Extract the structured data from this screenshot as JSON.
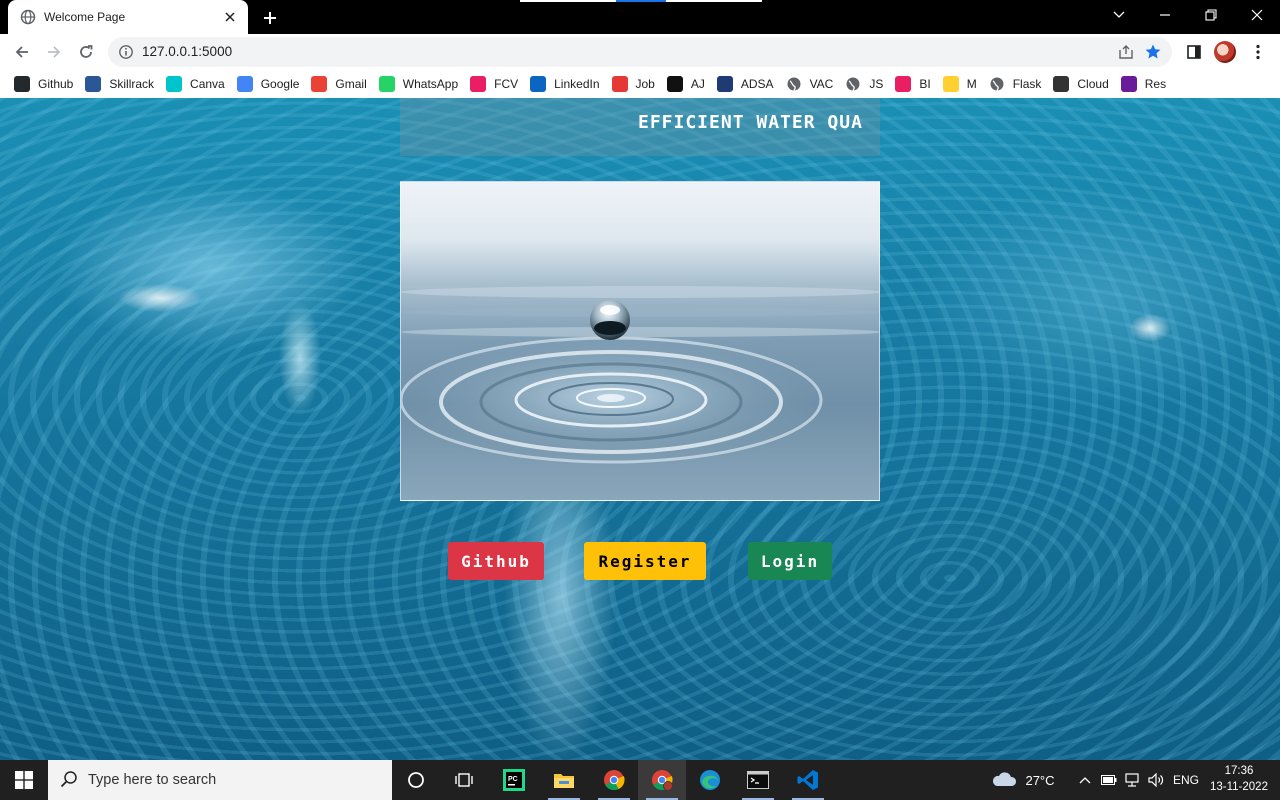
{
  "browser": {
    "tab_title": "Welcome Page",
    "url": "127.0.0.1:5000"
  },
  "bookmarks": [
    {
      "label": "Github",
      "icon": "github-icon",
      "color": "#24292e"
    },
    {
      "label": "Skillrack",
      "icon": "skillrack-icon",
      "color": "#2b5797"
    },
    {
      "label": "Canva",
      "icon": "canva-icon",
      "color": "#00c4cc"
    },
    {
      "label": "Google",
      "icon": "google-icon",
      "color": "#4285f4"
    },
    {
      "label": "Gmail",
      "icon": "gmail-icon",
      "color": "#ea4335"
    },
    {
      "label": "WhatsApp",
      "icon": "whatsapp-icon",
      "color": "#25d366"
    },
    {
      "label": "FCV",
      "icon": "fcv-icon",
      "color": "#e91e63"
    },
    {
      "label": "LinkedIn",
      "icon": "linkedin-icon",
      "color": "#0a66c2"
    },
    {
      "label": "Job",
      "icon": "job-icon",
      "color": "#e53935"
    },
    {
      "label": "AJ",
      "icon": "amazon-icon",
      "color": "#111111"
    },
    {
      "label": "ADSA",
      "icon": "ADSA-icon",
      "color": "#1f3b73"
    },
    {
      "label": "VAC",
      "icon": "globe-icon",
      "color": "#5f6368"
    },
    {
      "label": "JS",
      "icon": "globe-icon",
      "color": "#5f6368"
    },
    {
      "label": "BI",
      "icon": "bi-icon",
      "color": "#e91e63"
    },
    {
      "label": "M",
      "icon": "miro-icon",
      "color": "#ffd02f"
    },
    {
      "label": "Flask",
      "icon": "globe-icon",
      "color": "#5f6368"
    },
    {
      "label": "Cloud",
      "icon": "cloud-icon",
      "color": "#333333"
    },
    {
      "label": "Res",
      "icon": "res-icon",
      "color": "#6a1b9a"
    }
  ],
  "page": {
    "banner_text": "EFFICIENT WATER QUA",
    "buttons": {
      "github": "Github",
      "register": "Register",
      "login": "Login"
    }
  },
  "taskbar": {
    "search_placeholder": "Type here to search",
    "weather": "27°C",
    "language": "ENG",
    "time": "17:36",
    "date": "13-11-2022"
  }
}
